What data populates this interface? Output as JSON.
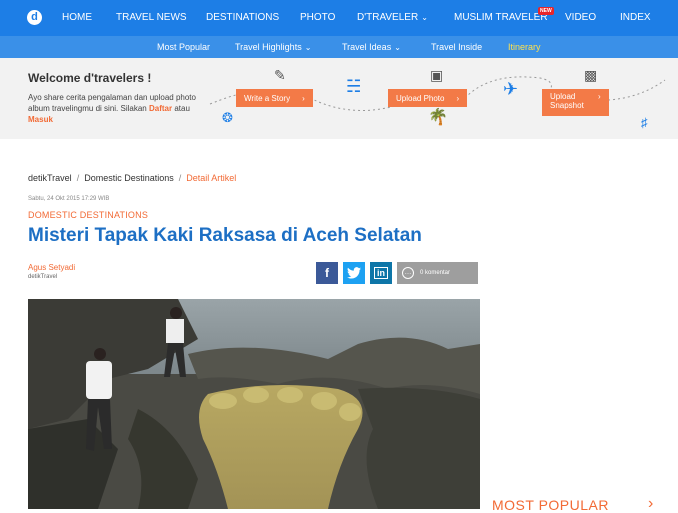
{
  "brand": {
    "logo_letter": "d"
  },
  "topnav": {
    "items": [
      "HOME",
      "TRAVEL NEWS",
      "DESTINATIONS",
      "PHOTO",
      "D'TRAVELER",
      "MUSLIM TRAVELER",
      "VIDEO",
      "INDEX"
    ],
    "new_badge": "NEW"
  },
  "subnav": {
    "items": [
      "Most Popular",
      "Travel Highlights",
      "Travel Ideas",
      "Travel Inside",
      "Itinerary"
    ]
  },
  "banner": {
    "title": "Welcome d'travelers !",
    "text": "Ayo share cerita pengalaman dan upload photo album travelingmu di sini. Silakan",
    "signup": "Daftar",
    "or": "atau",
    "login": "Masuk",
    "buttons": [
      "Write a Story",
      "Upload Photo",
      "Upload Snapshot"
    ]
  },
  "breadcrumb": {
    "items": [
      "detikTravel",
      "Domestic Destinations",
      "Detail Artikel"
    ]
  },
  "article": {
    "date": "Sabtu, 24 Okt 2015 17:29 WIB",
    "category": "DOMESTIC DESTINATIONS",
    "title": "Misteri Tapak Kaki Raksasa di Aceh Selatan",
    "author": "Agus Setyadi",
    "source": "detikTravel",
    "comments": "0 komentar"
  },
  "share": {
    "facebook": "f",
    "twitter": "t",
    "linkedin": "in"
  },
  "sidebar": {
    "most_popular": "MOST POPULAR"
  },
  "colors": {
    "nav_blue": "#1d7ee6",
    "accent_orange": "#f26a35",
    "title_blue": "#1d6fc4"
  }
}
